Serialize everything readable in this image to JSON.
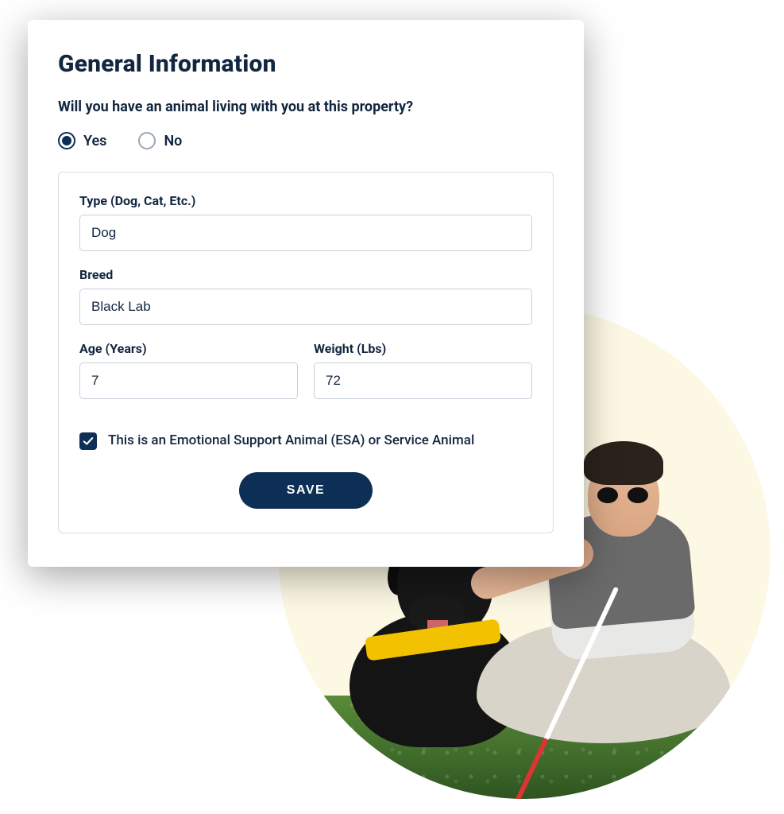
{
  "heading": "General Information",
  "question": "Will you have an animal living with you at this property?",
  "radio": {
    "yes": "Yes",
    "no": "No",
    "selected": "yes"
  },
  "fields": {
    "type": {
      "label": "Type (Dog, Cat, Etc.)",
      "value": "Dog"
    },
    "breed": {
      "label": "Breed",
      "value": "Black Lab"
    },
    "age": {
      "label": "Age (Years)",
      "value": "7"
    },
    "weight": {
      "label": "Weight (Lbs)",
      "value": "72"
    }
  },
  "esa_checkbox": {
    "label": "This is an Emotional Support Animal (ESA) or Service Animal",
    "checked": true
  },
  "save_label": "SAVE",
  "colors": {
    "primary": "#0e2f55",
    "text": "#12263f",
    "border": "#c7d0db",
    "circle_bg": "#fdf8e3"
  },
  "illustration": {
    "description": "Man with sunglasses and white cane sitting on grass petting a black Labrador service dog with yellow harness",
    "subject_dog": "black-lab",
    "subject_person": "man-with-cane"
  }
}
